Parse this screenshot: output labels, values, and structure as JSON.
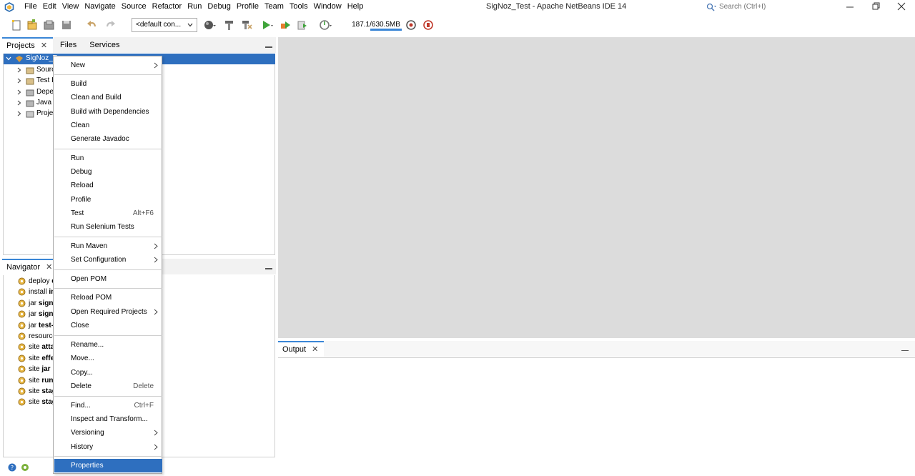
{
  "app": {
    "title": "SigNoz_Test - Apache NetBeans IDE 14",
    "menu": [
      "File",
      "Edit",
      "View",
      "Navigate",
      "Source",
      "Refactor",
      "Run",
      "Debug",
      "Profile",
      "Team",
      "Tools",
      "Window",
      "Help"
    ],
    "search_placeholder": "Search (Ctrl+I)"
  },
  "toolbar": {
    "config_value": "<default con...",
    "memory": "187.1/630.5MB"
  },
  "projects_panel": {
    "tabs": [
      {
        "label": "Projects",
        "close": "✕"
      },
      {
        "label": "Files"
      },
      {
        "label": "Services"
      }
    ],
    "tree": [
      {
        "label": "SigNoz_T"
      },
      {
        "label": "Sourc"
      },
      {
        "label": "Test I"
      },
      {
        "label": "Depe"
      },
      {
        "label": "Java I"
      },
      {
        "label": "Proje"
      }
    ]
  },
  "navigator_panel": {
    "tab": {
      "label": "Navigator",
      "close": "✕"
    },
    "items": [
      {
        "prefix": "deploy ",
        "bold": "d"
      },
      {
        "prefix": "install ",
        "bold": "in"
      },
      {
        "prefix": "jar ",
        "bold": "sign"
      },
      {
        "prefix": "jar ",
        "bold": "sign-"
      },
      {
        "prefix": "jar ",
        "bold": "test-j"
      },
      {
        "prefix": "resource",
        "bold": ""
      },
      {
        "prefix": "site ",
        "bold": "attac"
      },
      {
        "prefix": "site ",
        "bold": "effe"
      },
      {
        "prefix": "site ",
        "bold": "jar"
      },
      {
        "prefix": "site ",
        "bold": "run"
      },
      {
        "prefix": "site ",
        "bold": "stag"
      },
      {
        "prefix": "site ",
        "bold": "stag"
      }
    ]
  },
  "output_panel": {
    "tab": {
      "label": "Output",
      "close": "✕"
    }
  },
  "context_menu": {
    "items": {
      "new": "New",
      "build": "Build",
      "clean_build": "Clean and Build",
      "build_deps": "Build with Dependencies",
      "clean": "Clean",
      "javadoc": "Generate Javadoc",
      "run": "Run",
      "debug": "Debug",
      "reload": "Reload",
      "profile": "Profile",
      "test": "Test",
      "test_shortcut": "Alt+F6",
      "selenium": "Run Selenium Tests",
      "run_maven": "Run Maven",
      "set_config": "Set Configuration",
      "open_pom": "Open POM",
      "reload_pom": "Reload POM",
      "open_required": "Open Required Projects",
      "close": "Close",
      "rename": "Rename...",
      "move": "Move...",
      "copy": "Copy...",
      "delete": "Delete",
      "delete_shortcut": "Delete",
      "find": "Find...",
      "find_shortcut": "Ctrl+F",
      "inspect": "Inspect and Transform...",
      "versioning": "Versioning",
      "history": "History",
      "properties": "Properties"
    }
  },
  "colors": {
    "accent": "#2e6fbf",
    "editor_bg": "#dcdcdc"
  },
  "icons": [
    "netbeans-logo-icon",
    "search-icon",
    "new-file-icon",
    "new-project-icon",
    "open-project-icon",
    "save-icon",
    "undo-icon",
    "redo-icon",
    "globe-icon",
    "build-hammer-icon",
    "clean-build-icon",
    "run-icon",
    "debug-icon",
    "profile-icon",
    "gear-icon",
    "help-icon"
  ]
}
